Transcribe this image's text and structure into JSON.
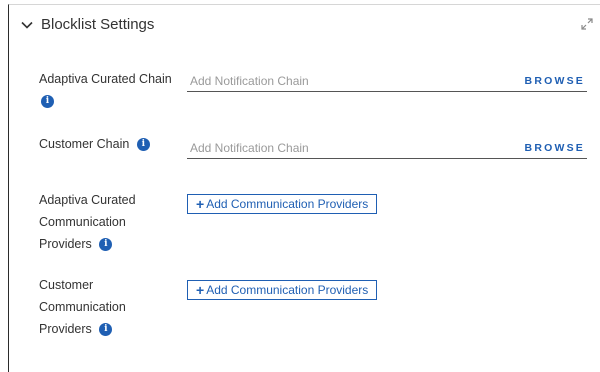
{
  "section": {
    "title": "Blocklist Settings"
  },
  "fields": {
    "curated_chain": {
      "label": "Adaptiva Curated Chain",
      "placeholder": "Add Notification Chain",
      "browse": "BROWSE"
    },
    "customer_chain": {
      "label": "Customer Chain",
      "placeholder": "Add Notification Chain",
      "browse": "BROWSE"
    },
    "curated_providers": {
      "label_line1": "Adaptiva Curated",
      "label_line2": "Communication",
      "label_line3": "Providers",
      "button": "Add Communication Providers"
    },
    "customer_providers": {
      "label_line1": "Customer",
      "label_line2": "Communication",
      "label_line3": "Providers",
      "button": "Add Communication Providers"
    }
  },
  "icons": {
    "info": "info-icon",
    "chevron": "chevron-down-icon",
    "expand": "expand-icon"
  },
  "colors": {
    "accent": "#1f5fb3",
    "text": "#333333",
    "placeholder": "#9a9a9a"
  }
}
